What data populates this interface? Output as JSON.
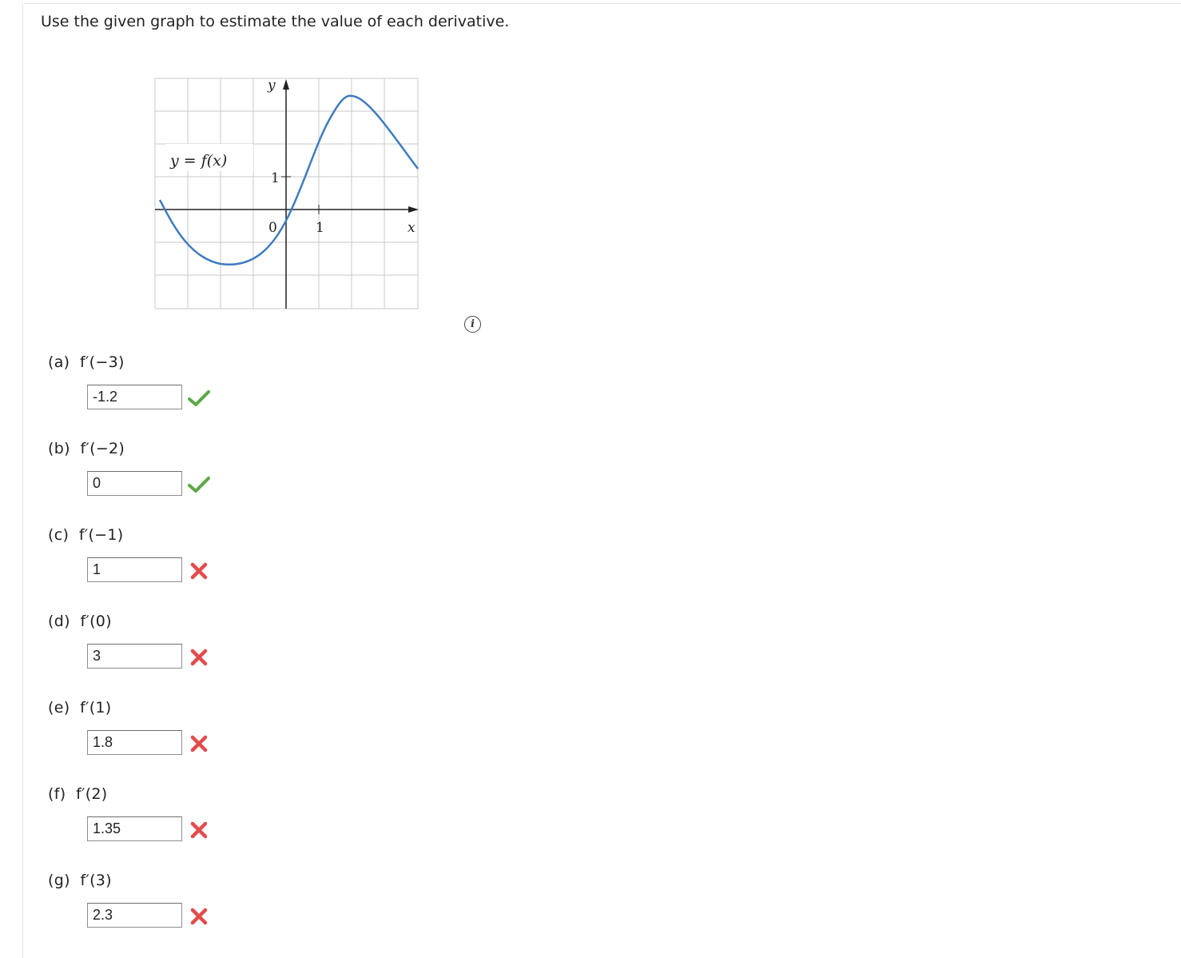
{
  "instructions": "Use the given graph to estimate the value of each derivative.",
  "graph": {
    "y_axis_label": "y",
    "x_axis_label": "x",
    "function_label": "y = f(x)",
    "tick_y": "1",
    "tick_x": "1",
    "origin_label": "0",
    "curve_color": "#3d7bbf"
  },
  "info_icon": {
    "glyph": "i",
    "icon": "info-icon"
  },
  "parts": [
    {
      "label": "(a)  f′(−3)",
      "value": "-1.2",
      "status": "correct"
    },
    {
      "label": "(b)  f′(−2)",
      "value": "0",
      "status": "correct"
    },
    {
      "label": "(c)  f′(−1)",
      "value": "1",
      "status": "incorrect"
    },
    {
      "label": "(d)  f′(0)",
      "value": "3",
      "status": "incorrect"
    },
    {
      "label": "(e)  f′(1)",
      "value": "1.8",
      "status": "incorrect"
    },
    {
      "label": "(f)  f′(2)",
      "value": "1.35",
      "status": "incorrect"
    },
    {
      "label": "(g)  f′(3)",
      "value": "2.3",
      "status": "incorrect"
    }
  ],
  "colors": {
    "correct": "#5aa845",
    "incorrect": "#e34b4b"
  }
}
